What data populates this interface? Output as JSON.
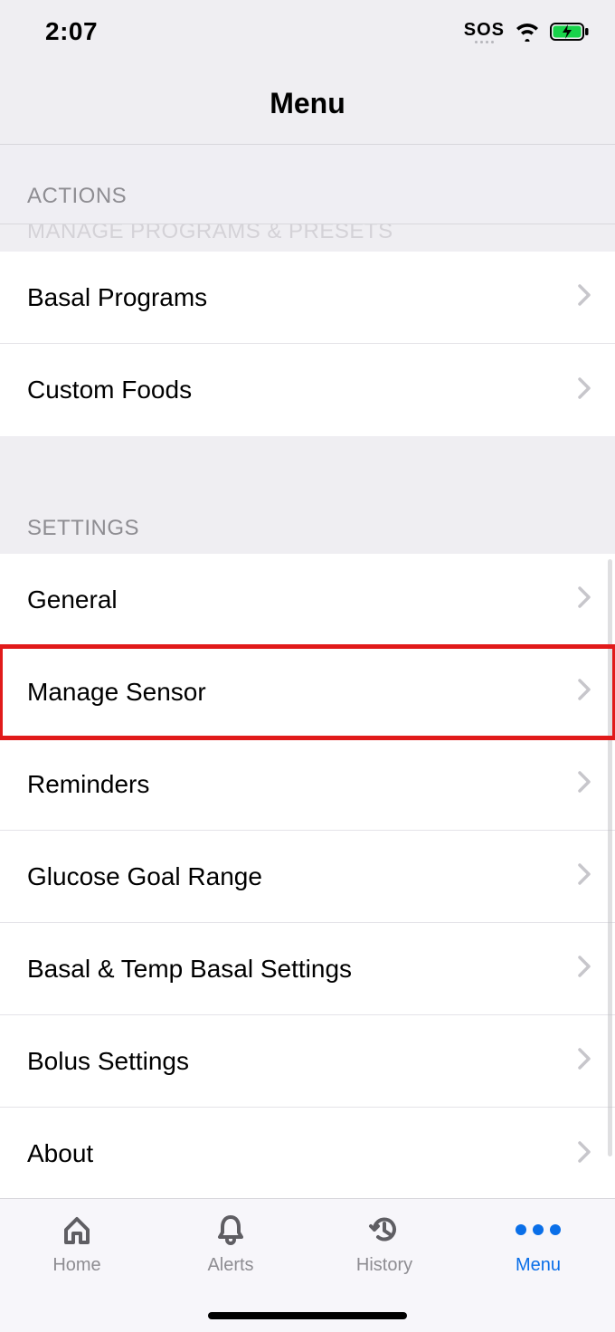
{
  "status": {
    "time": "2:07",
    "sos": "SOS"
  },
  "nav": {
    "title": "Menu"
  },
  "headers": {
    "actions": "ACTIONS",
    "ghost": "MANAGE PROGRAMS & PRESETS",
    "settings": "SETTINGS"
  },
  "programs": {
    "items": [
      {
        "label": "Basal Programs"
      },
      {
        "label": "Custom Foods"
      }
    ]
  },
  "settings": {
    "items": [
      {
        "label": "General"
      },
      {
        "label": "Manage Sensor",
        "highlight": true
      },
      {
        "label": "Reminders"
      },
      {
        "label": "Glucose Goal Range"
      },
      {
        "label": "Basal & Temp Basal Settings"
      },
      {
        "label": "Bolus Settings"
      },
      {
        "label": "About"
      }
    ]
  },
  "tabs": {
    "items": [
      {
        "label": "Home"
      },
      {
        "label": "Alerts"
      },
      {
        "label": "History"
      },
      {
        "label": "Menu"
      }
    ]
  }
}
